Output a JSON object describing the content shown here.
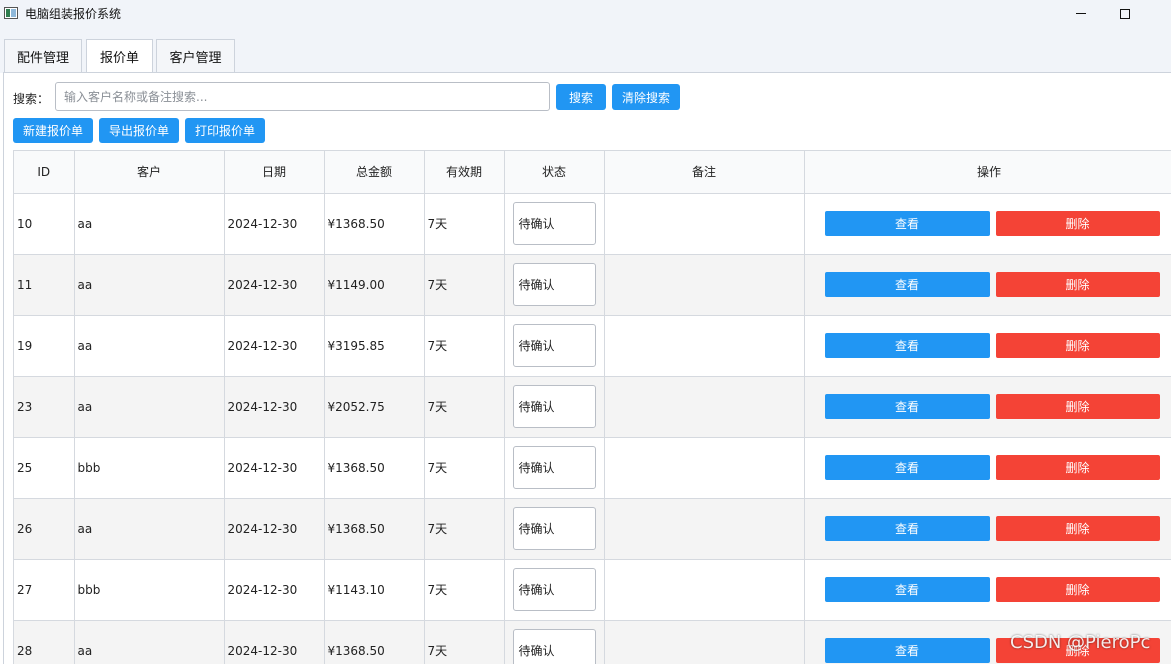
{
  "window": {
    "title": "电脑组装报价系统"
  },
  "tabs": [
    {
      "label": "配件管理"
    },
    {
      "label": "报价单"
    },
    {
      "label": "客户管理"
    }
  ],
  "search": {
    "label": "搜索：",
    "placeholder": "输入客户名称或备注搜索...",
    "value": "",
    "search_button": "搜索",
    "clear_button": "清除搜索"
  },
  "toolbar": {
    "new_label": "新建报价单",
    "export_label": "导出报价单",
    "print_label": "打印报价单"
  },
  "table": {
    "columns": [
      "ID",
      "客户",
      "日期",
      "总金额",
      "有效期",
      "状态",
      "备注",
      "操作"
    ],
    "rows": [
      {
        "id": "10",
        "customer": "aa",
        "date": "2024-12-30",
        "total": "¥1368.50",
        "validity": "7天",
        "status": "待确认",
        "note": "",
        "view": "查看",
        "delete": "删除"
      },
      {
        "id": "11",
        "customer": "aa",
        "date": "2024-12-30",
        "total": "¥1149.00",
        "validity": "7天",
        "status": "待确认",
        "note": "",
        "view": "查看",
        "delete": "删除"
      },
      {
        "id": "19",
        "customer": "aa",
        "date": "2024-12-30",
        "total": "¥3195.85",
        "validity": "7天",
        "status": "待确认",
        "note": "",
        "view": "查看",
        "delete": "删除"
      },
      {
        "id": "23",
        "customer": "aa",
        "date": "2024-12-30",
        "total": "¥2052.75",
        "validity": "7天",
        "status": "待确认",
        "note": "",
        "view": "查看",
        "delete": "删除"
      },
      {
        "id": "25",
        "customer": "bbb",
        "date": "2024-12-30",
        "total": "¥1368.50",
        "validity": "7天",
        "status": "待确认",
        "note": "",
        "view": "查看",
        "delete": "删除"
      },
      {
        "id": "26",
        "customer": "aa",
        "date": "2024-12-30",
        "total": "¥1368.50",
        "validity": "7天",
        "status": "待确认",
        "note": "",
        "view": "查看",
        "delete": "删除"
      },
      {
        "id": "27",
        "customer": "bbb",
        "date": "2024-12-30",
        "total": "¥1143.10",
        "validity": "7天",
        "status": "待确认",
        "note": "",
        "view": "查看",
        "delete": "删除"
      },
      {
        "id": "28",
        "customer": "aa",
        "date": "2024-12-30",
        "total": "¥1368.50",
        "validity": "7天",
        "status": "待确认",
        "note": "",
        "view": "查看",
        "delete": "删除"
      }
    ]
  },
  "watermark": "CSDN @PieroPc",
  "colors": {
    "primary": "#2196f3",
    "danger": "#f44336",
    "row_alt": "#f4f4f4"
  }
}
